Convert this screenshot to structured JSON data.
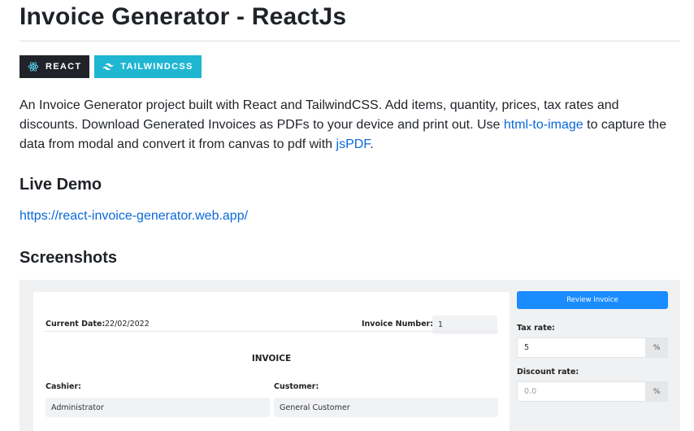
{
  "readme": {
    "title": "Invoice Generator - ReactJs",
    "badges": [
      {
        "label": "REACT",
        "icon": "react-icon",
        "bg": "#20232a"
      },
      {
        "label": "TAILWINDCSS",
        "icon": "tailwind-icon",
        "bg": "#1fb6d2"
      }
    ],
    "description": {
      "part1": "An Invoice Generator project built with React and TailwindCSS. Add items, quantity, prices, tax rates and discounts. Download Generated Invoices as PDFs to your device and print out. Use ",
      "link1": "html-to-image",
      "part2": " to capture the data from modal and convert it from canvas to pdf with ",
      "link2": "jsPDF",
      "part3": "."
    },
    "live_demo_heading": "Live Demo",
    "live_demo_url": "https://react-invoice-generator.web.app/",
    "screenshots_heading": "Screenshots"
  },
  "screenshot": {
    "current_date_label": "Current Date:",
    "current_date_value": "22/02/2022",
    "invoice_number_label": "Invoice Number:",
    "invoice_number_value": "1",
    "invoice_heading": "INVOICE",
    "cashier_label": "Cashier:",
    "cashier_value": "Administrator",
    "customer_label": "Customer:",
    "customer_value": "General Customer",
    "review_button": "Review Invoice",
    "tax_rate_label": "Tax rate:",
    "tax_rate_value": "5",
    "discount_rate_label": "Discount rate:",
    "discount_rate_placeholder": "0.0",
    "percent_suffix": "%"
  },
  "colors": {
    "link": "#0969da",
    "review_button": "#1b8cff"
  }
}
